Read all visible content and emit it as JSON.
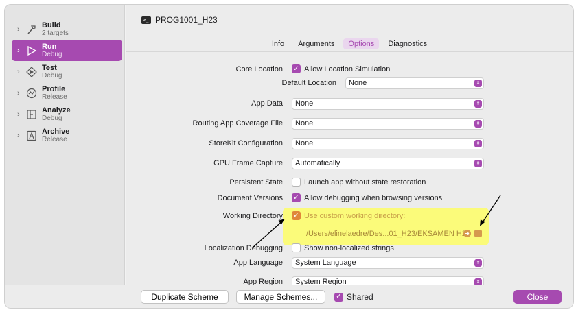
{
  "sidebar": {
    "items": [
      {
        "title": "Build",
        "subtitle": "2 targets",
        "icon": "hammer-icon"
      },
      {
        "title": "Run",
        "subtitle": "Debug",
        "icon": "play-icon"
      },
      {
        "title": "Test",
        "subtitle": "Debug",
        "icon": "diamond-play-icon"
      },
      {
        "title": "Profile",
        "subtitle": "Release",
        "icon": "gauge-icon"
      },
      {
        "title": "Analyze",
        "subtitle": "Debug",
        "icon": "analyze-icon"
      },
      {
        "title": "Archive",
        "subtitle": "Release",
        "icon": "archive-icon"
      }
    ]
  },
  "header": {
    "scheme_name": "PROG1001_H23",
    "terminal_glyph": ">_"
  },
  "tabs": [
    "Info",
    "Arguments",
    "Options",
    "Diagnostics"
  ],
  "active_tab": "Options",
  "options": {
    "core_location": {
      "label": "Core Location",
      "checkbox": "Allow Location Simulation",
      "checked": true
    },
    "default_location": {
      "label": "Default Location",
      "value": "None"
    },
    "app_data": {
      "label": "App Data",
      "value": "None"
    },
    "routing": {
      "label": "Routing App Coverage File",
      "value": "None"
    },
    "storekit": {
      "label": "StoreKit Configuration",
      "value": "None"
    },
    "gpu": {
      "label": "GPU Frame Capture",
      "value": "Automatically"
    },
    "persistent": {
      "label": "Persistent State",
      "checkbox": "Launch app without state restoration",
      "checked": false
    },
    "doc_versions": {
      "label": "Document Versions",
      "checkbox": "Allow debugging when browsing versions",
      "checked": true
    },
    "working_dir": {
      "label": "Working Directory",
      "checkbox": "Use custom working directory:",
      "checked": true,
      "path": "/Users/elinelaedre/Des...01_H23/EKSAMEN H22"
    },
    "localization": {
      "label": "Localization Debugging",
      "checkbox": "Show non-localized strings",
      "checked": false
    },
    "app_language": {
      "label": "App Language",
      "value": "System Language"
    },
    "app_region": {
      "label": "App Region",
      "value": "System Region"
    }
  },
  "footer": {
    "duplicate": "Duplicate Scheme",
    "manage": "Manage Schemes...",
    "shared": "Shared",
    "close": "Close"
  },
  "colors": {
    "accent": "#a64ab0",
    "highlight": "#fbfb7a",
    "warn": "#e0873a"
  }
}
